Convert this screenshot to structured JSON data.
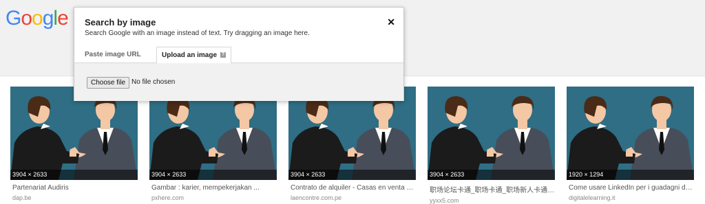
{
  "logo": {
    "letters": [
      "G",
      "o",
      "o",
      "g",
      "l",
      "e"
    ],
    "colors": [
      "#4285F4",
      "#EA4335",
      "#FBBC05",
      "#4285F4",
      "#34A853",
      "#EA4335"
    ]
  },
  "dialog": {
    "title": "Search by image",
    "subtitle": "Search Google with an image instead of text. Try dragging an image here.",
    "close_glyph": "✕",
    "tabs": [
      {
        "label": "Paste image URL"
      },
      {
        "label": "Upload an image",
        "help_glyph": "?"
      }
    ],
    "choose_file_label": "Choose file",
    "no_file_text": "No file chosen"
  },
  "results": [
    {
      "dims": "3904 × 2633",
      "title": "Partenariat Audiris",
      "site": "dap.be"
    },
    {
      "dims": "3904 × 2633",
      "title": "Gambar : karier, mempekerjakan ...",
      "site": "pxhere.com"
    },
    {
      "dims": "3904 × 2633",
      "title": "Contrato de alquiler - Casas en venta y ...",
      "site": "laencontre.com.pe"
    },
    {
      "dims": "3904 × 2633",
      "title": "职场论坛卡通_职场卡通_职场新人卡通_...",
      "site": "yyxx5.com"
    },
    {
      "dims": "1920 × 1294",
      "title": "Come usare LinkedIn per i guadagni del ...",
      "site": "digitalelearning.it"
    }
  ],
  "colors": {
    "thumb_bg": "#2f6e84",
    "suit_dark": "#1b1b1b",
    "suit_grey": "#474e5a",
    "skin": "#f4c7a5",
    "hair": "#4a2b17"
  }
}
